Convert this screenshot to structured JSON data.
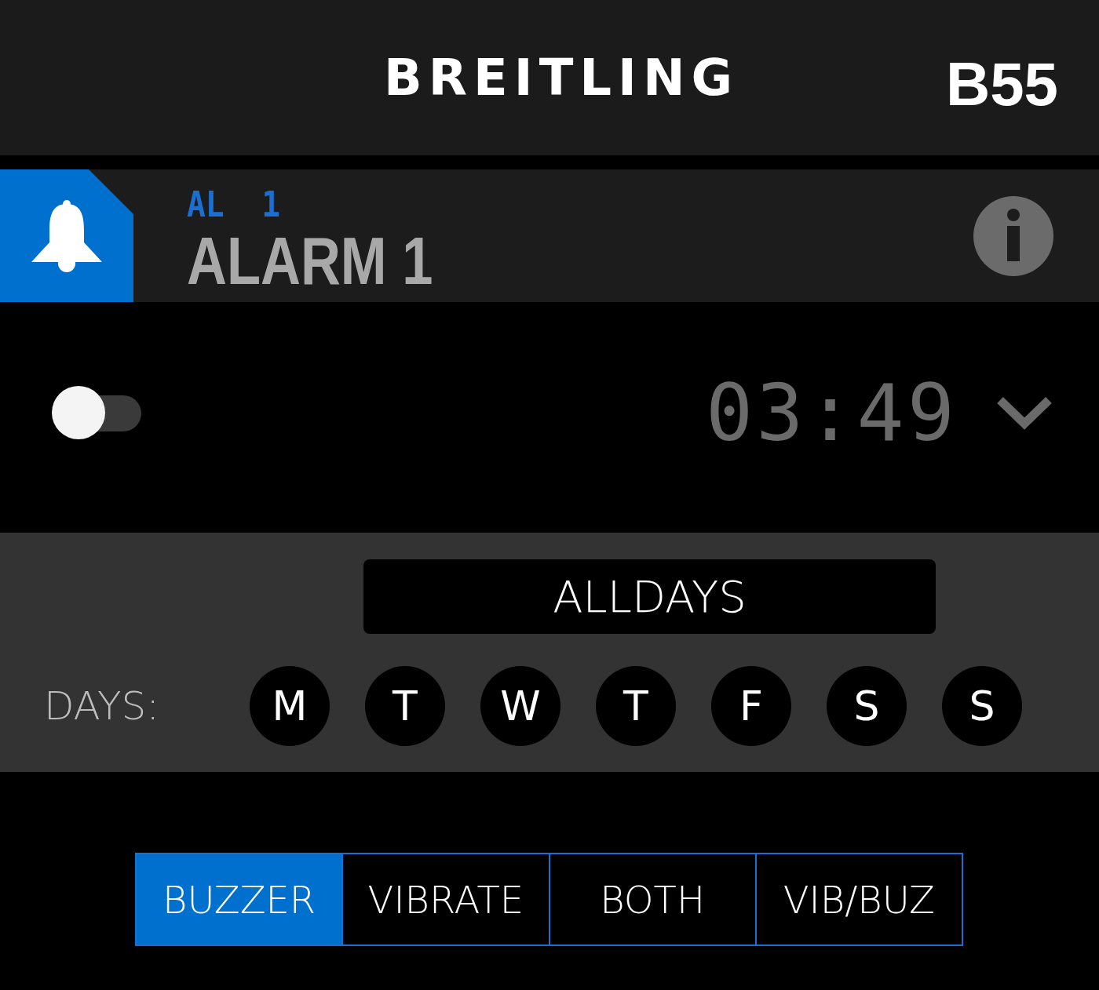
{
  "header": {
    "brand": "BREITLING",
    "model": "B55"
  },
  "alarm": {
    "code": "AL  1",
    "title": "ALARM 1"
  },
  "enabled": false,
  "time": "03:49",
  "repeat_button": "ALLDAYS",
  "days_label": "DAYS:",
  "days": [
    "M",
    "T",
    "W",
    "T",
    "F",
    "S",
    "S"
  ],
  "modes": [
    {
      "label": "BUZZER",
      "selected": true
    },
    {
      "label": "VIBRATE",
      "selected": false
    },
    {
      "label": "BOTH",
      "selected": false
    },
    {
      "label": "VIB/BUZ",
      "selected": false
    }
  ]
}
